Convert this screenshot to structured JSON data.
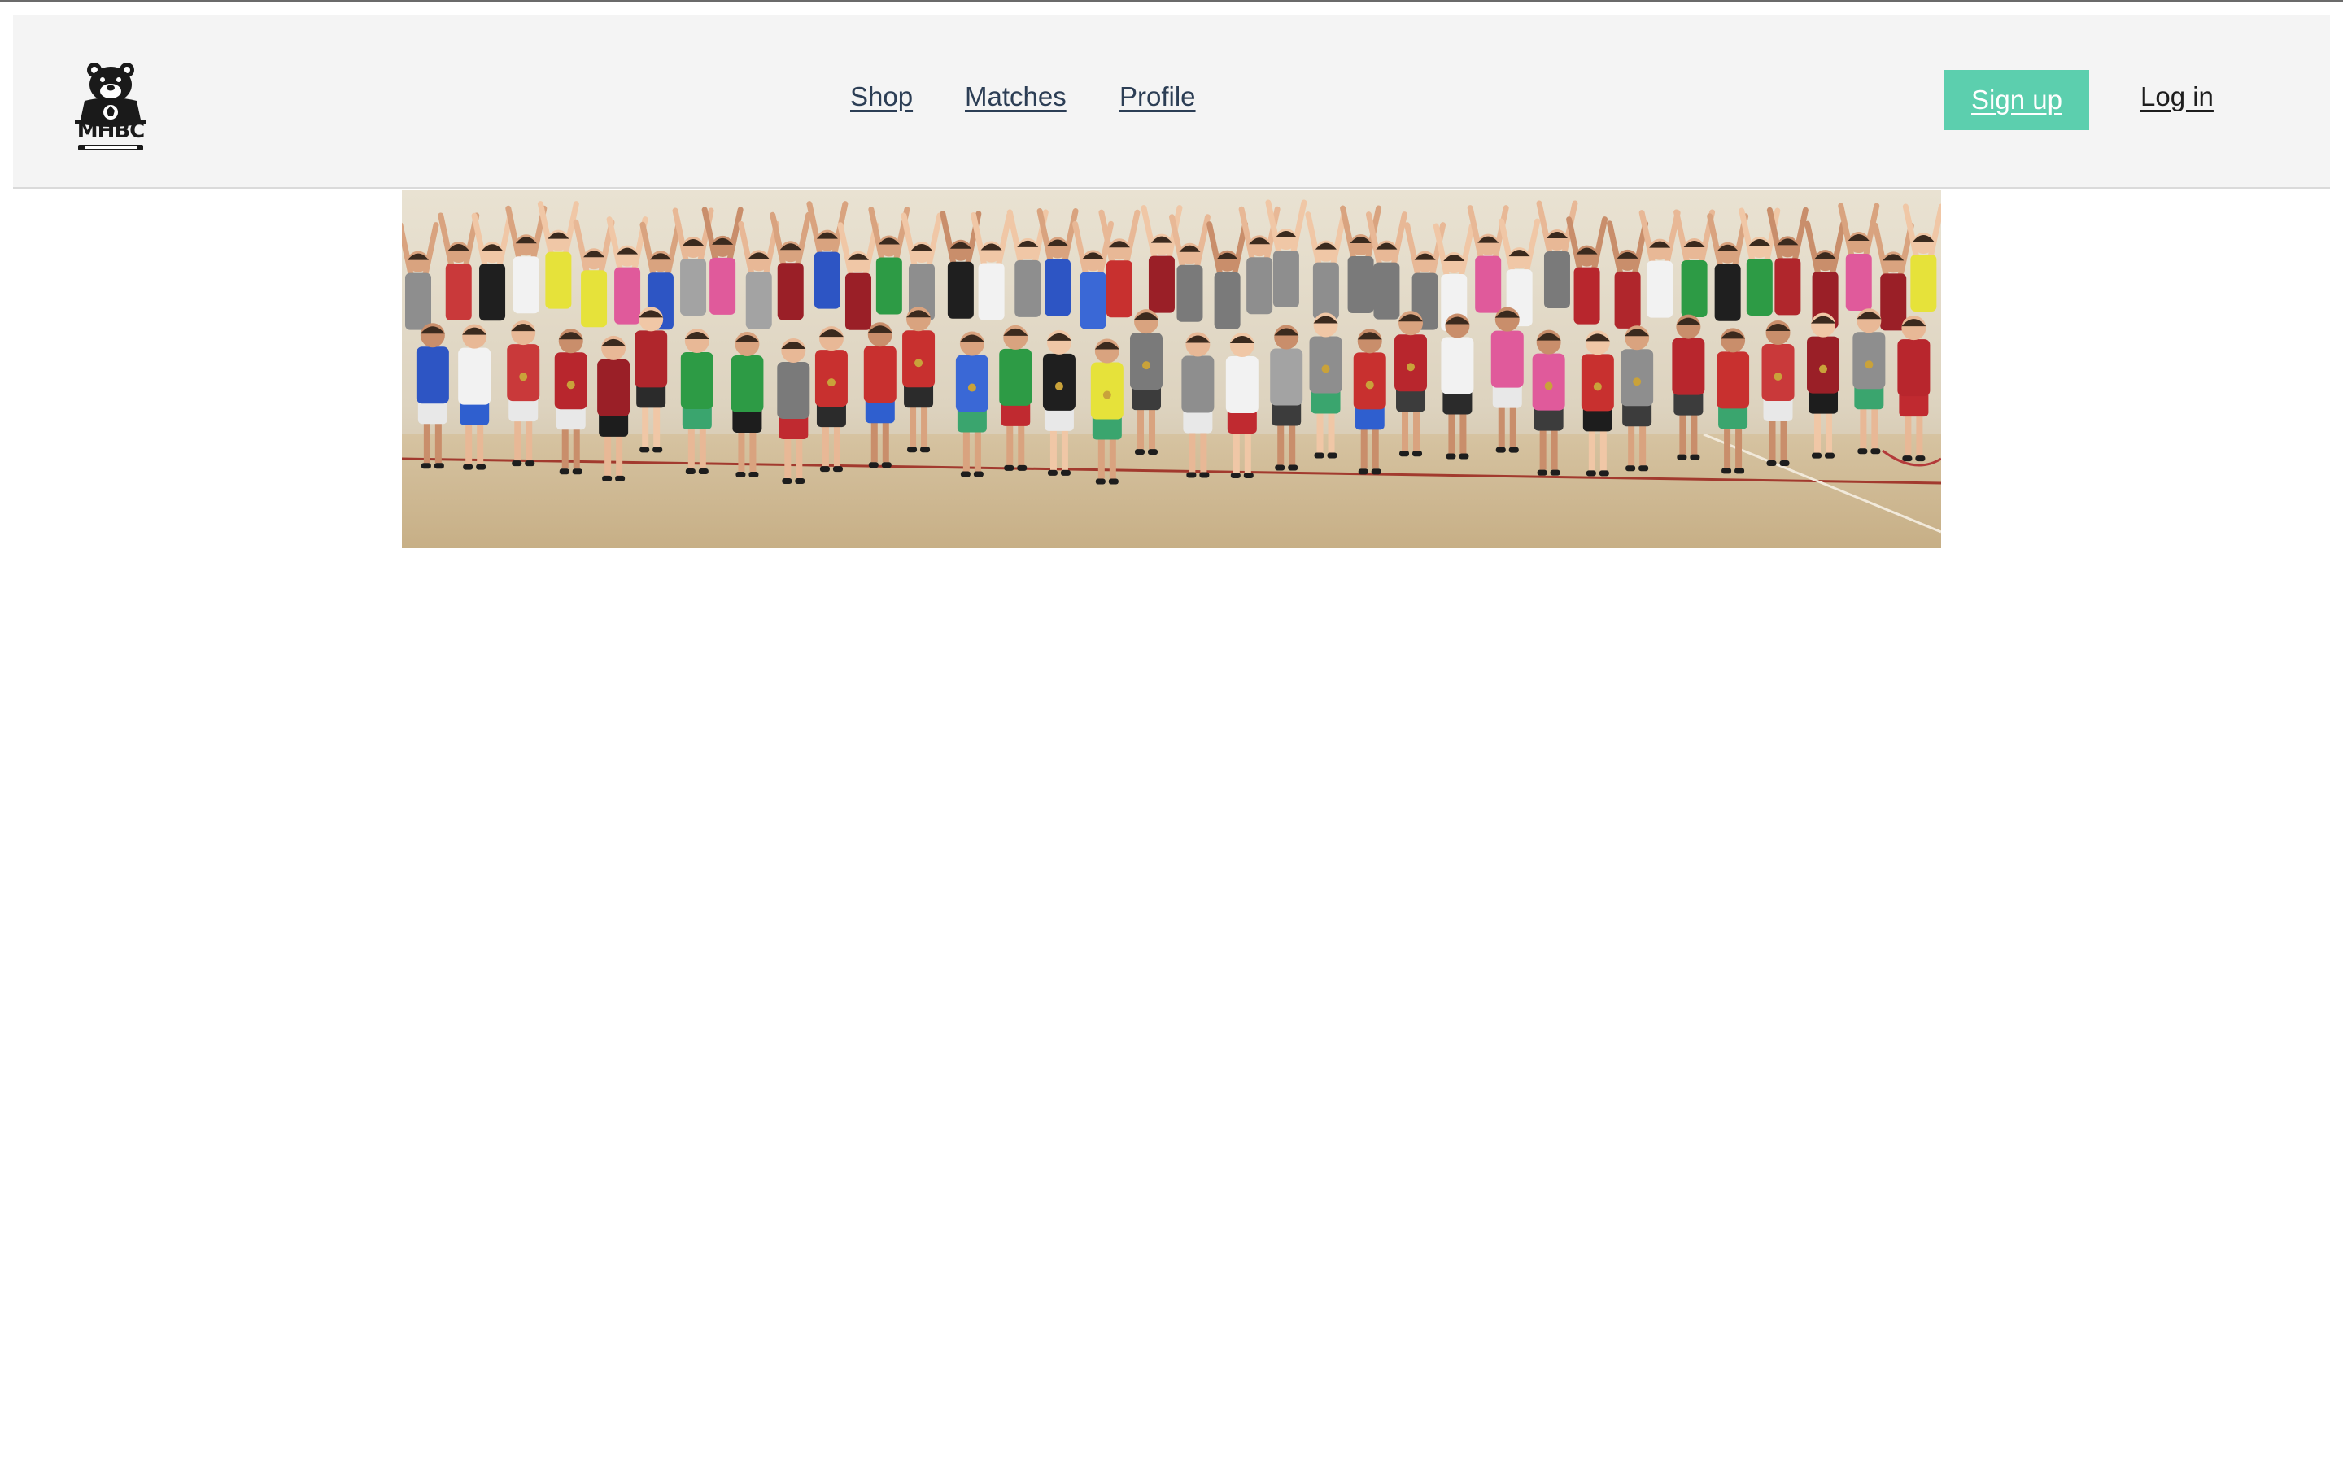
{
  "header": {
    "logo": {
      "text": "MHBC",
      "icon": "bear-mascot-icon"
    },
    "nav": [
      {
        "label": "Shop"
      },
      {
        "label": "Matches"
      },
      {
        "label": "Profile"
      }
    ],
    "signup_label": "Sign up",
    "login_label": "Log in"
  },
  "hero": {
    "description_icon": "team-photo-image"
  },
  "colors": {
    "header_bg": "#f4f4f4",
    "accent": "#5ccfae",
    "nav_text": "#2c3e55",
    "login_text": "#1d1d1d"
  }
}
